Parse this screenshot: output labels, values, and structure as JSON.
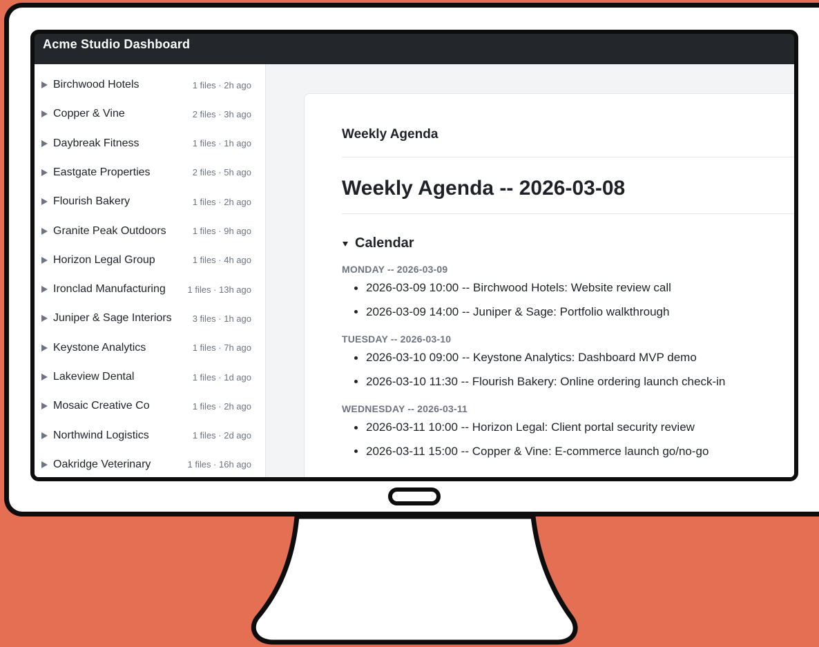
{
  "app": {
    "title": "Acme Studio Dashboard"
  },
  "sidebar": {
    "items": [
      {
        "name": "Birchwood Hotels",
        "meta": "1 files · 2h ago"
      },
      {
        "name": "Copper & Vine",
        "meta": "2 files · 3h ago"
      },
      {
        "name": "Daybreak Fitness",
        "meta": "1 files · 1h ago"
      },
      {
        "name": "Eastgate Properties",
        "meta": "2 files · 5h ago"
      },
      {
        "name": "Flourish Bakery",
        "meta": "1 files · 2h ago"
      },
      {
        "name": "Granite Peak Outdoors",
        "meta": "1 files · 9h ago"
      },
      {
        "name": "Horizon Legal Group",
        "meta": "1 files · 4h ago"
      },
      {
        "name": "Ironclad Manufacturing",
        "meta": "1 files · 13h ago"
      },
      {
        "name": "Juniper & Sage Interiors",
        "meta": "3 files · 1h ago"
      },
      {
        "name": "Keystone Analytics",
        "meta": "1 files · 7h ago"
      },
      {
        "name": "Lakeview Dental",
        "meta": "1 files · 1d ago"
      },
      {
        "name": "Mosaic Creative Co",
        "meta": "1 files · 2h ago"
      },
      {
        "name": "Northwind Logistics",
        "meta": "1 files · 2d ago"
      },
      {
        "name": "Oakridge Veterinary",
        "meta": "1 files · 16h ago"
      }
    ]
  },
  "document": {
    "card_title": "Weekly Agenda",
    "heading": "Weekly Agenda -- 2026-03-08",
    "section_title": "Calendar",
    "days": [
      {
        "label": "MONDAY -- 2026-03-09",
        "events": [
          "2026-03-09 10:00 -- Birchwood Hotels: Website review call",
          "2026-03-09 14:00 -- Juniper & Sage: Portfolio walkthrough"
        ]
      },
      {
        "label": "TUESDAY -- 2026-03-10",
        "events": [
          "2026-03-10 09:00 -- Keystone Analytics: Dashboard MVP demo",
          "2026-03-10 11:30 -- Flourish Bakery: Online ordering launch check-in"
        ]
      },
      {
        "label": "WEDNESDAY -- 2026-03-11",
        "events": [
          "2026-03-11 10:00 -- Horizon Legal: Client portal security review",
          "2026-03-11 15:00 -- Copper & Vine: E-commerce launch go/no-go"
        ]
      }
    ]
  },
  "colors": {
    "background": "#e56f52",
    "header": "#23272b",
    "muted_text": "#6b7480",
    "text": "#1e2228"
  },
  "icons": {
    "collapsed": "triangle-right-icon",
    "expanded": "triangle-down-icon"
  }
}
